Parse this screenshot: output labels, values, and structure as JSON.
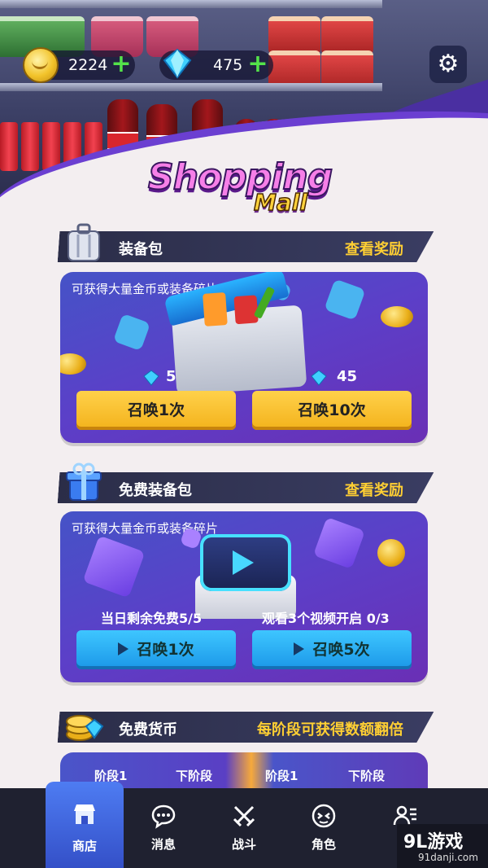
{
  "resources": {
    "coins": "2224",
    "gems": "475",
    "coin_icon": "coin-icon",
    "gem_icon": "gem-icon",
    "add_icon": "plus-icon"
  },
  "settings_icon": "gear-icon",
  "logo": {
    "line1": "Shopping",
    "line2": "Mall"
  },
  "sections": {
    "equipment_pack": {
      "title": "装备包",
      "link": "查看奖励",
      "subtitle": "可获得大量金币或装备碎片",
      "summon_1_label": "召唤1次",
      "summon_1_cost": "5",
      "summon_10_label": "召唤10次",
      "summon_10_cost": "45"
    },
    "free_equipment_pack": {
      "title": "免费装备包",
      "link": "查看奖励",
      "subtitle": "可获得大量金币或装备碎片",
      "daily_free": "当日剩余免费5/5",
      "watch_videos": "观看3个视频开启 0/3",
      "summon_1_label": "召唤1次",
      "summon_5_label": "召唤5次"
    },
    "free_currency": {
      "title": "免费货币",
      "link": "每阶段可获得数额翻倍",
      "stage_a": "阶段1",
      "next_a": "下阶段",
      "stage_b": "阶段1",
      "next_b": "下阶段"
    }
  },
  "tabs": [
    {
      "label": "商店",
      "icon": "shop-icon",
      "active": true
    },
    {
      "label": "消息",
      "icon": "chat-icon"
    },
    {
      "label": "战斗",
      "icon": "crossed-swords-icon"
    },
    {
      "label": "角色",
      "icon": "character-icon"
    },
    {
      "label": "",
      "icon": "profile-list-icon"
    }
  ],
  "watermark": {
    "logo": "9L游戏",
    "url": "91danji.com"
  },
  "colors": {
    "accent_gold": "#ffcf33",
    "button_gold": "#f3b21b",
    "button_blue": "#1b97e8",
    "card_purple": "#5c3fc8",
    "tab_active": "#3450c8"
  }
}
